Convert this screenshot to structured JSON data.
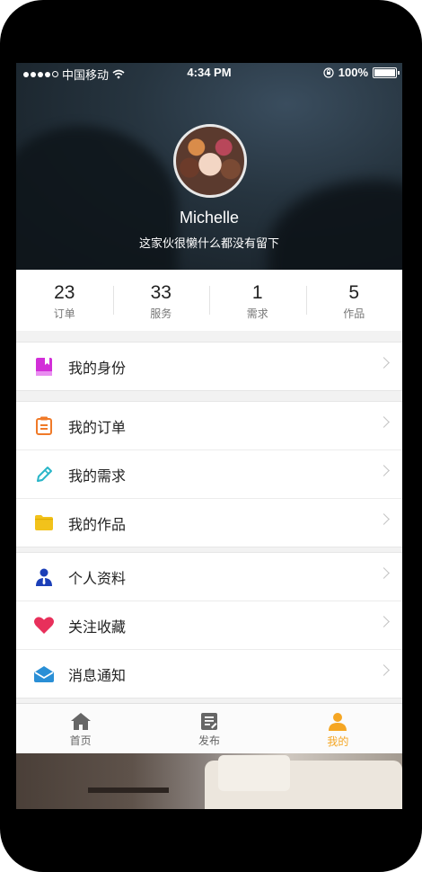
{
  "status_bar": {
    "carrier": "中国移动",
    "time": "4:34 PM",
    "battery": "100%"
  },
  "profile": {
    "name": "Michelle",
    "tagline": "这家伙很懒什么都没有留下"
  },
  "stats": [
    {
      "value": "23",
      "label": "订单"
    },
    {
      "value": "33",
      "label": "服务"
    },
    {
      "value": "1",
      "label": "需求"
    },
    {
      "value": "5",
      "label": "作品"
    }
  ],
  "menu": {
    "identity": "我的身份",
    "orders": "我的订单",
    "requests": "我的需求",
    "works": "我的作品",
    "profile_info": "个人资料",
    "favorites": "关注收藏",
    "notifications": "消息通知"
  },
  "tabs": [
    {
      "label": "首页",
      "icon": "home-icon"
    },
    {
      "label": "发布",
      "icon": "publish-icon"
    },
    {
      "label": "我的",
      "icon": "user-icon"
    }
  ],
  "colors": {
    "active_tab": "#f5a623",
    "identity_icon": "#d22fd8",
    "orders_icon": "#f07a28",
    "requests_icon": "#2ab6c8",
    "works_icon": "#f2c21b",
    "profile_icon": "#1b3fb8",
    "favorites_icon": "#e8305b",
    "notify_icon": "#2a8fd6"
  }
}
